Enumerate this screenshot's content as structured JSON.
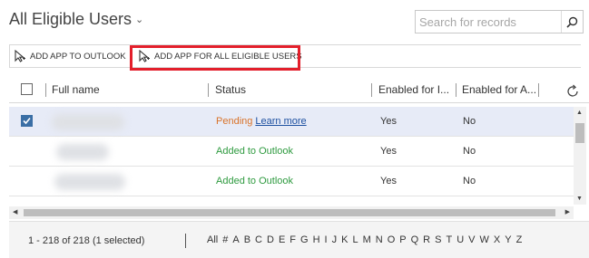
{
  "header": {
    "title": "All Eligible Users",
    "title_chevron": "⌄"
  },
  "search": {
    "placeholder": "Search for records",
    "value": ""
  },
  "toolbar": {
    "add_to_outlook_label": "ADD APP TO OUTLOOK",
    "add_for_all_label": "ADD APP FOR ALL ELIGIBLE USERS"
  },
  "grid": {
    "columns": [
      {
        "label": "Full name"
      },
      {
        "label": "Status"
      },
      {
        "label": "Enabled for I..."
      },
      {
        "label": "Enabled for A..."
      }
    ],
    "rows": [
      {
        "selected": true,
        "status": "Pending",
        "status_link": "Learn more",
        "enabled_i": "Yes",
        "enabled_a": "No"
      },
      {
        "selected": false,
        "status": "Added to Outlook",
        "status_link": "",
        "enabled_i": "Yes",
        "enabled_a": "No"
      },
      {
        "selected": false,
        "status": "Added to Outlook",
        "status_link": "",
        "enabled_i": "Yes",
        "enabled_a": "No"
      }
    ]
  },
  "footer": {
    "record_count": "1 - 218 of 218 (1 selected)",
    "alpha_filters": [
      "All",
      "#",
      "A",
      "B",
      "C",
      "D",
      "E",
      "F",
      "G",
      "H",
      "I",
      "J",
      "K",
      "L",
      "M",
      "N",
      "O",
      "P",
      "Q",
      "R",
      "S",
      "T",
      "U",
      "V",
      "W",
      "X",
      "Y",
      "Z"
    ]
  },
  "colors": {
    "highlight": "#e31f2b",
    "pending": "#d9732a",
    "added": "#2e9a3f",
    "link": "#1c4fa0",
    "selected_row": "#e7ebf7"
  },
  "icons": {
    "search": "search-icon",
    "chevron": "chevron-down-icon",
    "add_app": "add-app-icon",
    "refresh": "refresh-icon",
    "checkbox": "checkbox-icon"
  }
}
